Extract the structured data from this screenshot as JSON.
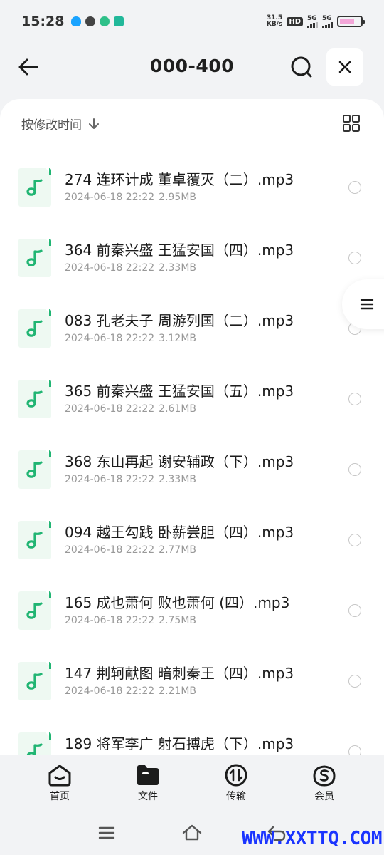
{
  "status_bar": {
    "time": "15:28",
    "net_speed_value": "31.5",
    "net_speed_unit": "KB/s",
    "hd_label": "HD",
    "sim1": "5G",
    "sim2": "5G",
    "battery_level": 0.7,
    "battery_color": "#f3a6d8"
  },
  "header": {
    "title": "000-400",
    "back_icon": "arrow-left-icon",
    "search_icon": "search-icon",
    "close_icon": "close-icon"
  },
  "sortbar": {
    "label": "按修改时间",
    "arrow_icon": "arrow-down-icon",
    "view_icon": "grid-view-icon"
  },
  "files": [
    {
      "name": "274 连环计成 董卓覆灭（二）.mp3",
      "date": "2024-06-18 22:22",
      "size": "2.95MB"
    },
    {
      "name": "364 前秦兴盛 王猛安国（四）.mp3",
      "date": "2024-06-18 22:22",
      "size": "2.33MB"
    },
    {
      "name": "083 孔老夫子 周游列国（二）.mp3",
      "date": "2024-06-18 22:22",
      "size": "3.12MB"
    },
    {
      "name": "365 前秦兴盛 王猛安国（五）.mp3",
      "date": "2024-06-18 22:22",
      "size": "2.61MB"
    },
    {
      "name": "368 东山再起 谢安辅政（下）.mp3",
      "date": "2024-06-18 22:22",
      "size": "2.33MB"
    },
    {
      "name": "094 越王勾践 卧薪尝胆（四）.mp3",
      "date": "2024-06-18 22:22",
      "size": "2.77MB"
    },
    {
      "name": "165 成也萧何 败也萧何 (四）.mp3",
      "date": "2024-06-18 22:22",
      "size": "2.75MB"
    },
    {
      "name": "147 荆轲献图 暗刺秦王（四）.mp3",
      "date": "2024-06-18 22:22",
      "size": "2.21MB"
    },
    {
      "name": "189 将军李广 射石搏虎（下）.mp3",
      "date": "",
      "size": ""
    }
  ],
  "bottom_nav": {
    "home": "首页",
    "files": "文件",
    "transfer": "传输",
    "member": "会员"
  },
  "watermark": "WWW.XXTTQ.COM",
  "colors": {
    "accent": "#21b573",
    "icon_bg": "#eef9f2",
    "watermark": "#1a34ff"
  }
}
